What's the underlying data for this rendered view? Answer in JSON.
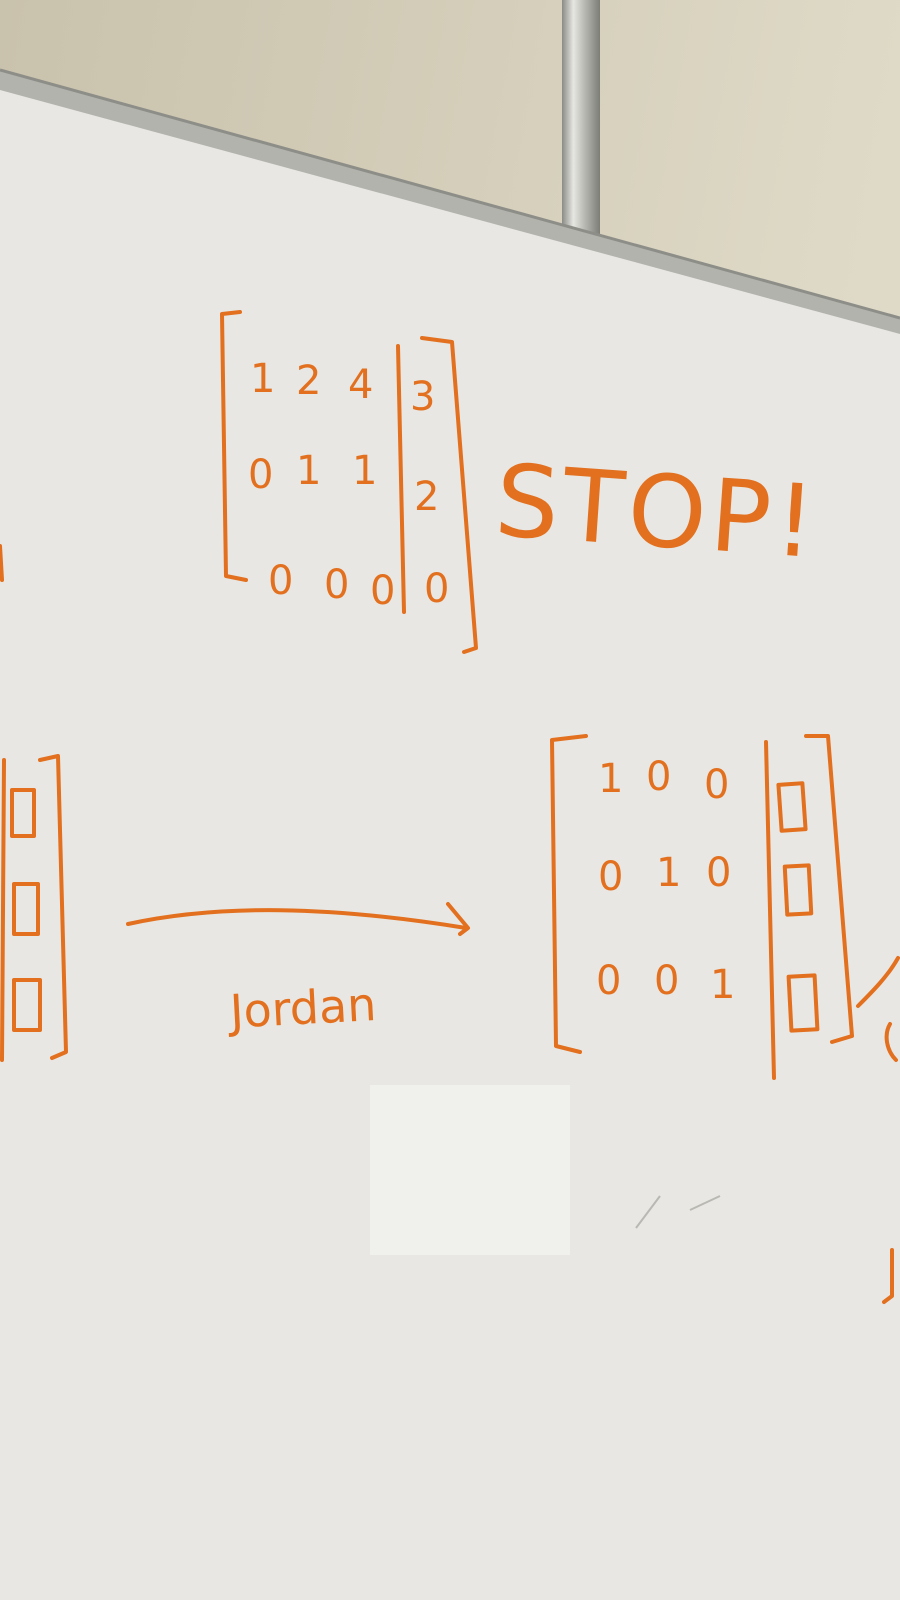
{
  "scene": {
    "description_colors": {
      "wall": "#d5cfbb",
      "board": "#e9e8e4",
      "marker": "#e2701f",
      "frame": "#9a9a95"
    }
  },
  "whiteboard": {
    "top_matrix": {
      "rows": [
        [
          "1",
          "2",
          "4",
          "3"
        ],
        [
          "0",
          "1",
          "1",
          "2"
        ],
        [
          "0",
          "0",
          "0",
          "0"
        ]
      ]
    },
    "stop_text": "STOP!",
    "arrow_label": "Jordan",
    "result_matrix": {
      "rows": [
        [
          "1",
          "0",
          "0"
        ],
        [
          "0",
          "1",
          "0"
        ],
        [
          "0",
          "0",
          "1"
        ]
      ]
    }
  }
}
